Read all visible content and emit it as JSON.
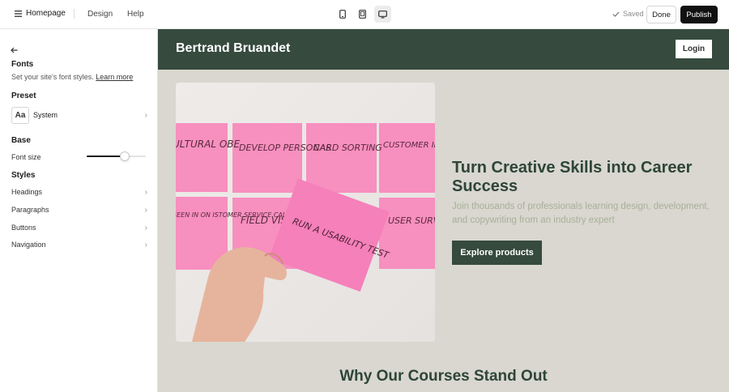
{
  "topbar": {
    "home_label": "Homepage",
    "design_label": "Design",
    "help_label": "Help",
    "devices": [
      "mobile-device-icon",
      "tablet-device-icon",
      "desktop-device-icon"
    ],
    "saved_label": "Saved",
    "done_label": "Done",
    "publish_label": "Publish"
  },
  "sidebar": {
    "fonts_heading": "Fonts",
    "fonts_subtitle": "Set your site's font styles.",
    "learn_more": "Learn more",
    "preset_heading": "Preset",
    "preset_icon_text": "Aa",
    "preset_value": "System",
    "base_heading": "Base",
    "font_size_label": "Font size",
    "font_size_level": 0.65,
    "styles_heading": "Styles",
    "style_items": [
      {
        "label": "Headings"
      },
      {
        "label": "Paragraphs"
      },
      {
        "label": "Buttons"
      },
      {
        "label": "Navigation"
      }
    ]
  },
  "preview": {
    "brand": "Bertrand Bruandet",
    "login_label": "Login",
    "hero_title": "Turn Creative Skills into Career Success",
    "hero_subtitle": "Join thousands of professionals learning design, development, and copywriting from an industry expert",
    "cta_label": "Explore products",
    "section_title": "Why Our Courses Stand Out",
    "image": {
      "notes": [
        "ULTURAL OBE",
        "DEVELOP PERSONAS",
        "CARD SORTING",
        "CUSTOMER INTERVIEWS",
        "SEEN IN ON ISTOMER SERVICE CALLS",
        "FIELD VISITS",
        "USER SURVEY"
      ],
      "held_note": "RUN A USABILITY TEST"
    }
  },
  "colors": {
    "header_green": "#364a3e",
    "title_green": "#2e4537",
    "preview_bg": "#d9d7cf",
    "subtitle_gray_green": "#a8b09a",
    "sticky_pink": "#f78fbf",
    "publish_black": "#111111"
  }
}
